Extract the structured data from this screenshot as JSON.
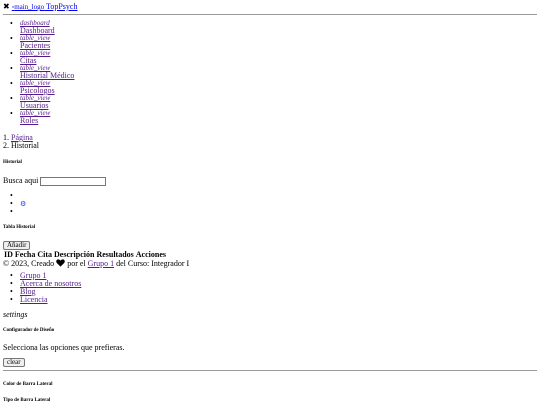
{
  "topbar": {
    "close_glyph": "✖",
    "logo_alt": "main_logo",
    "brand": "TopPsych"
  },
  "sidebar": {
    "items": [
      {
        "icon": "dashboard",
        "label": "Dashboard"
      },
      {
        "icon": "table_view",
        "label": "Pacientes"
      },
      {
        "icon": "table_view",
        "label": "Citas"
      },
      {
        "icon": "table_view",
        "label": "Historial Médico"
      },
      {
        "icon": "table_view",
        "label": "Psicologos"
      },
      {
        "icon": "table_view",
        "label": "Usuarios"
      },
      {
        "icon": "table_view",
        "label": "Roles"
      }
    ]
  },
  "breadcrumb": {
    "items": [
      {
        "number": "1.",
        "label": "Página"
      },
      {
        "number": "2.",
        "label": "Historial"
      }
    ]
  },
  "header": {
    "page_title": "Historial",
    "search_label": "Busca aqui",
    "search_value": ""
  },
  "table_section": {
    "title": "Tabla Historial",
    "add_button": "Añadir",
    "columns": [
      "ID",
      "Fecha Cita",
      "Descripción",
      "Resultados",
      "Acciones"
    ]
  },
  "footer": {
    "prefix": "© 2023, Creado",
    "middle": "por el",
    "group_link": "Grupo 1",
    "suffix": "del Curso: Integrador I",
    "links": [
      "Grupo 1",
      "Acerca de nosotros",
      "Blog",
      "Licencia"
    ]
  },
  "configurator": {
    "settings_icon_text": "settings",
    "title": "Configurador de Diseño",
    "subtitle": "Selecciona las opciones que prefieras.",
    "clear_button": "clear",
    "sidebar_color_title": "Color de Barra Lateral",
    "sidebar_type_title": "Tipo de Barra Lateral"
  },
  "colors": {
    "link": "#0000ee",
    "visited_link": "#551a8b",
    "gear": "#1a3fd6",
    "divider": "#9a9a9a"
  }
}
